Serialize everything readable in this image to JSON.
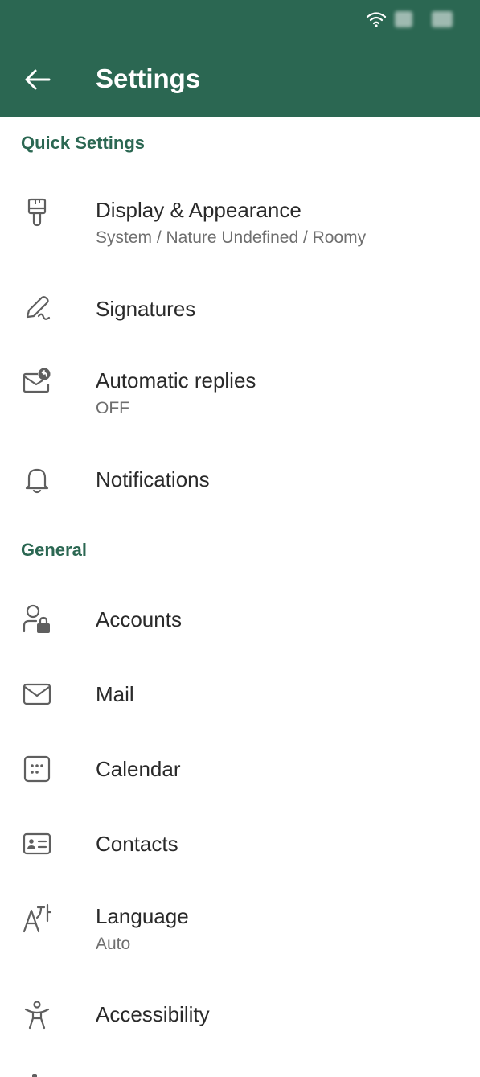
{
  "header": {
    "title": "Settings"
  },
  "sections": {
    "quick": {
      "title": "Quick Settings",
      "items": [
        {
          "label": "Display & Appearance",
          "subtitle": "System / Nature Undefined / Roomy",
          "icon": "paintbrush-icon"
        },
        {
          "label": "Signatures",
          "icon": "signature-pen-icon"
        },
        {
          "label": "Automatic replies",
          "subtitle": "OFF",
          "icon": "auto-reply-mail-icon"
        },
        {
          "label": "Notifications",
          "icon": "bell-icon"
        }
      ]
    },
    "general": {
      "title": "General",
      "items": [
        {
          "label": "Accounts",
          "icon": "person-lock-icon"
        },
        {
          "label": "Mail",
          "icon": "mail-icon"
        },
        {
          "label": "Calendar",
          "icon": "calendar-icon"
        },
        {
          "label": "Contacts",
          "icon": "contact-card-icon"
        },
        {
          "label": "Language",
          "subtitle": "Auto",
          "icon": "language-icon"
        },
        {
          "label": "Accessibility",
          "icon": "accessibility-icon"
        }
      ]
    }
  },
  "colors": {
    "appbar": "#2b6752",
    "accent": "#2b6752",
    "text": "#2a2a2a",
    "subtext": "#6f6f6f",
    "icon": "#5f5f5f"
  }
}
